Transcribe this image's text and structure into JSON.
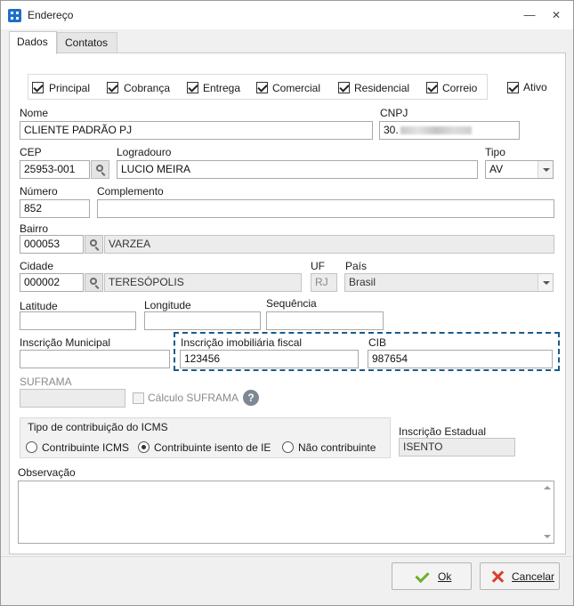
{
  "window": {
    "title": "Endereço"
  },
  "tabs": [
    {
      "label": "Dados",
      "active": true
    },
    {
      "label": "Contatos",
      "active": false
    }
  ],
  "checkboxes": [
    {
      "label": "Principal",
      "checked": true
    },
    {
      "label": "Cobrança",
      "checked": true
    },
    {
      "label": "Entrega",
      "checked": true
    },
    {
      "label": "Comercial",
      "checked": true
    },
    {
      "label": "Residencial",
      "checked": true
    },
    {
      "label": "Correio",
      "checked": true
    }
  ],
  "ativo": {
    "label": "Ativo",
    "checked": true
  },
  "fields": {
    "nome": {
      "label": "Nome",
      "value": "CLIENTE PADRÃO PJ"
    },
    "cnpj": {
      "label": "CNPJ",
      "value": "30."
    },
    "cep": {
      "label": "CEP",
      "value": "25953-001"
    },
    "logradouro": {
      "label": "Logradouro",
      "value": "LUCIO MEIRA"
    },
    "tipo": {
      "label": "Tipo",
      "value": "AV"
    },
    "numero": {
      "label": "Número",
      "value": "852"
    },
    "complemento": {
      "label": "Complemento",
      "value": ""
    },
    "bairro": {
      "label": "Bairro",
      "code": "000053",
      "name": "VARZEA"
    },
    "cidade": {
      "label": "Cidade",
      "code": "000002",
      "name": "TERESÓPOLIS"
    },
    "uf": {
      "label": "UF",
      "value": "RJ"
    },
    "pais": {
      "label": "País",
      "value": "Brasil"
    },
    "latitude": {
      "label": "Latitude",
      "value": ""
    },
    "longitude": {
      "label": "Longitude",
      "value": ""
    },
    "sequencia": {
      "label": "Sequência",
      "value": ""
    },
    "inscricao_municipal": {
      "label": "Inscrição Municipal",
      "value": ""
    },
    "inscricao_imobiliaria": {
      "label": "Inscrição imobiliária fiscal",
      "value": "123456"
    },
    "cib": {
      "label": "CIB",
      "value": "987654"
    },
    "suframa": {
      "label": "SUFRAMA",
      "value": ""
    },
    "calculo_suframa": {
      "label": "Cálculo SUFRAMA",
      "checked": false
    },
    "inscricao_estadual": {
      "label": "Inscrição Estadual",
      "value": "ISENTO"
    },
    "observacao": {
      "label": "Observação",
      "value": ""
    }
  },
  "icms": {
    "title": "Tipo de contribuição do ICMS",
    "options": [
      {
        "label": "Contribuinte ICMS",
        "selected": false
      },
      {
        "label": "Contribuinte isento de IE",
        "selected": true
      },
      {
        "label": "Não contribuinte",
        "selected": false
      }
    ]
  },
  "buttons": {
    "ok": "Ok",
    "cancel": "Cancelar"
  },
  "icons": {
    "help": "?"
  }
}
